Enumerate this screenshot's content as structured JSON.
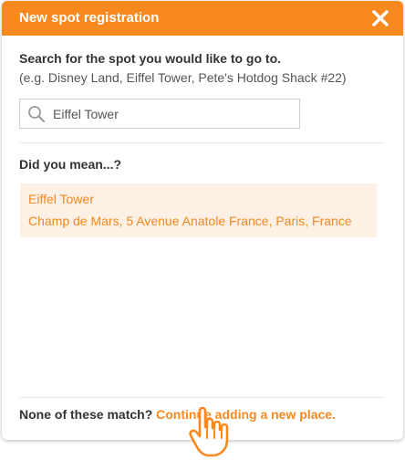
{
  "dialog": {
    "title": "New spot registration",
    "close_icon": "close-icon"
  },
  "search": {
    "prompt": "Search for the spot you would like to go to.",
    "example": "(e.g. Disney Land, Eiffel Tower, Pete's Hotdog Shack #22)",
    "value": "Eiffel Tower",
    "icon": "search-icon"
  },
  "suggestions": {
    "heading": "Did you mean...?",
    "items": [
      {
        "name": "Eiffel Tower",
        "address": "Champ de Mars, 5 Avenue Anatole France, Paris, France"
      }
    ]
  },
  "footer": {
    "text": "None of these match?",
    "link": "Continue adding a new place."
  },
  "cursor": "hand-pointer-icon",
  "colors": {
    "accent": "#f7891f",
    "suggestion_bg": "#fdf0e4",
    "text": "#333333"
  }
}
